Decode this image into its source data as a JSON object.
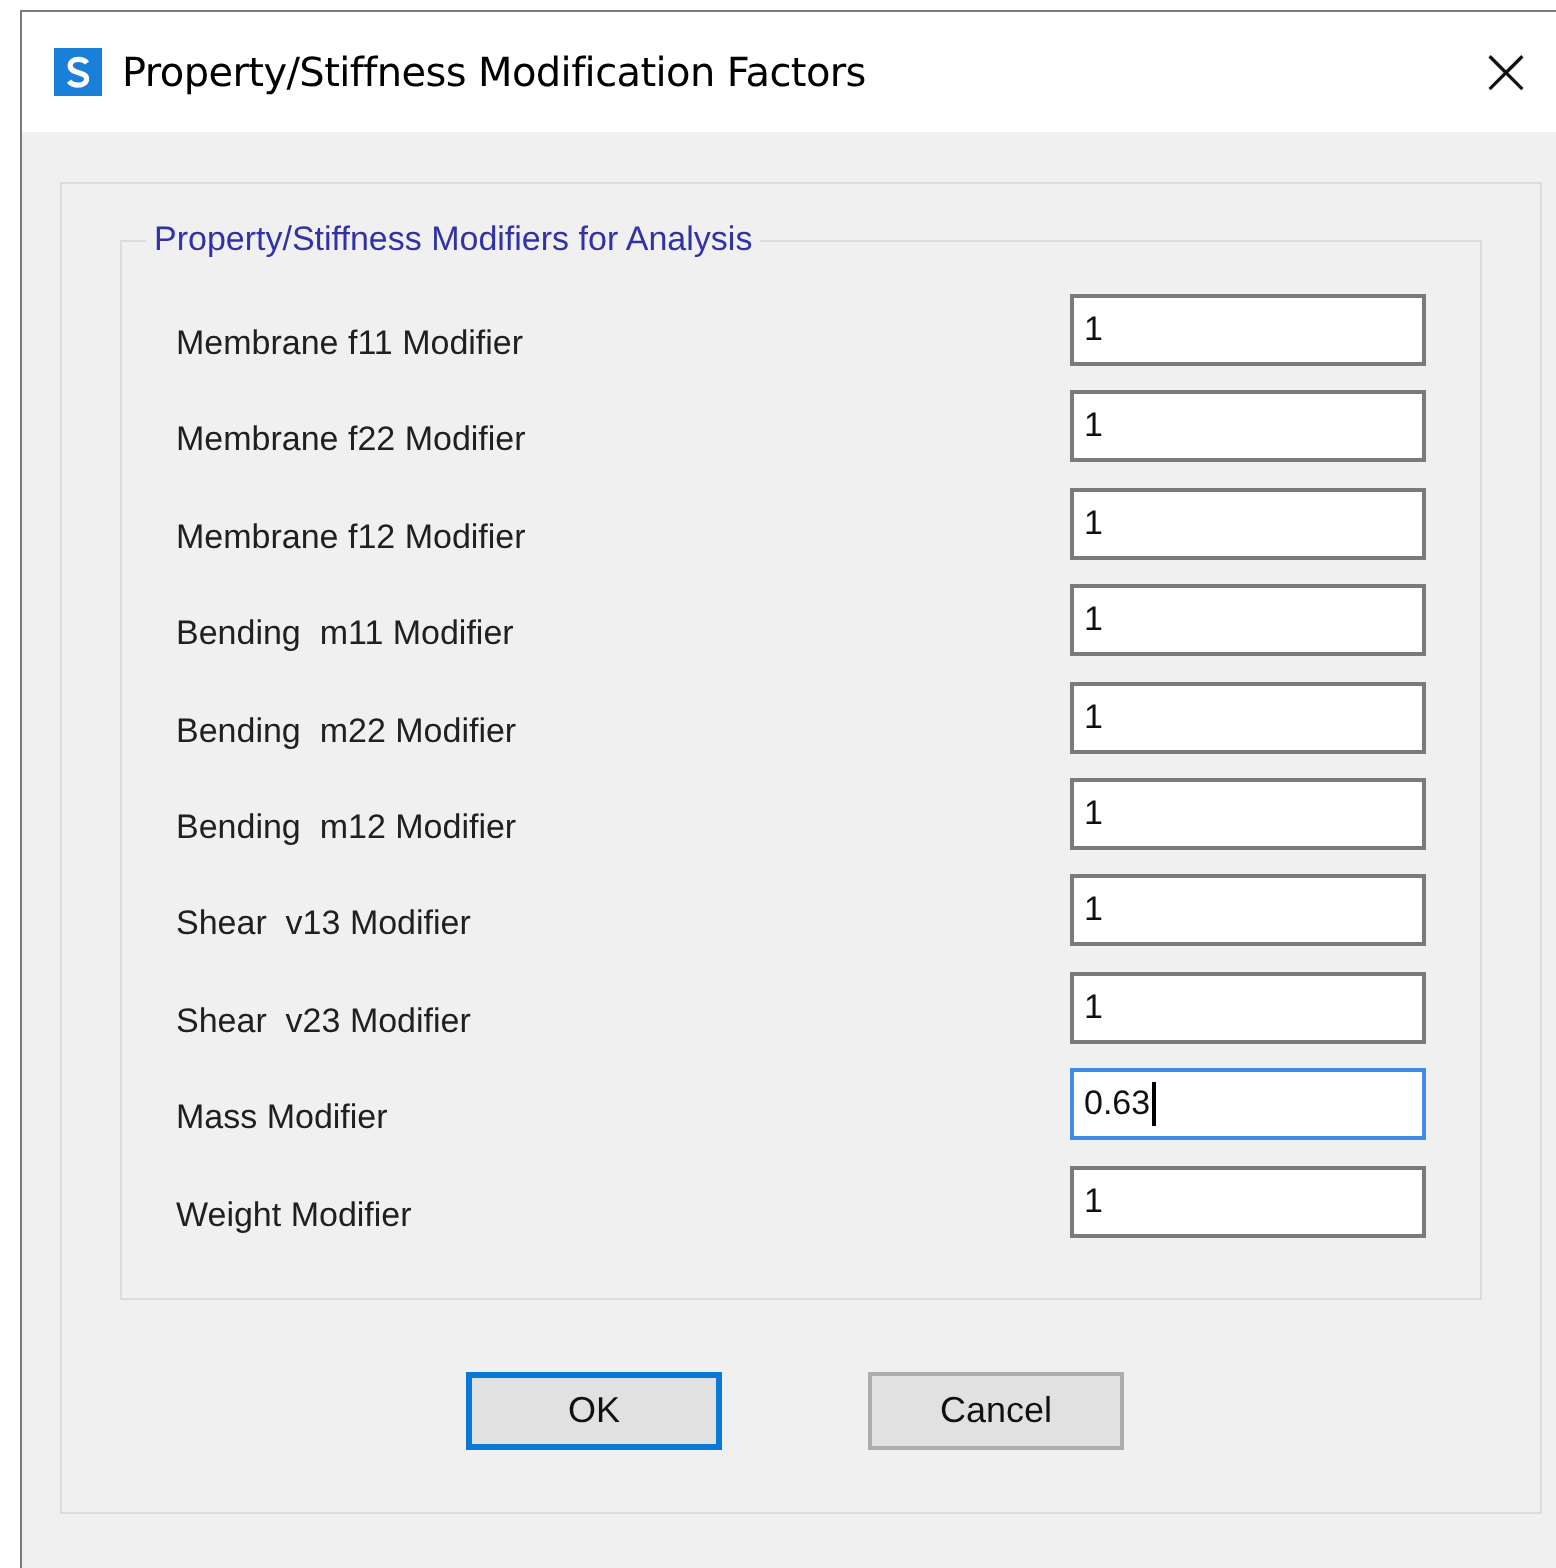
{
  "window": {
    "title": "Property/Stiffness Modification Factors",
    "close": "×"
  },
  "group": {
    "title": "Property/Stiffness Modifiers for Analysis",
    "fields": [
      {
        "label": "Membrane f11 Modifier",
        "value": "1",
        "focused": false
      },
      {
        "label": "Membrane f22 Modifier",
        "value": "1",
        "focused": false
      },
      {
        "label": "Membrane f12 Modifier",
        "value": "1",
        "focused": false
      },
      {
        "label": "Bending  m11 Modifier",
        "value": "1",
        "focused": false
      },
      {
        "label": "Bending  m22 Modifier",
        "value": "1",
        "focused": false
      },
      {
        "label": "Bending  m12 Modifier",
        "value": "1",
        "focused": false
      },
      {
        "label": "Shear  v13 Modifier",
        "value": "1",
        "focused": false
      },
      {
        "label": "Shear  v23 Modifier",
        "value": "1",
        "focused": false
      },
      {
        "label": "Mass Modifier",
        "value": "0.63",
        "focused": true
      },
      {
        "label": "Weight Modifier",
        "value": "1",
        "focused": false
      }
    ]
  },
  "buttons": [
    {
      "label": "OK",
      "default": true
    },
    {
      "label": "Cancel",
      "default": false
    }
  ]
}
